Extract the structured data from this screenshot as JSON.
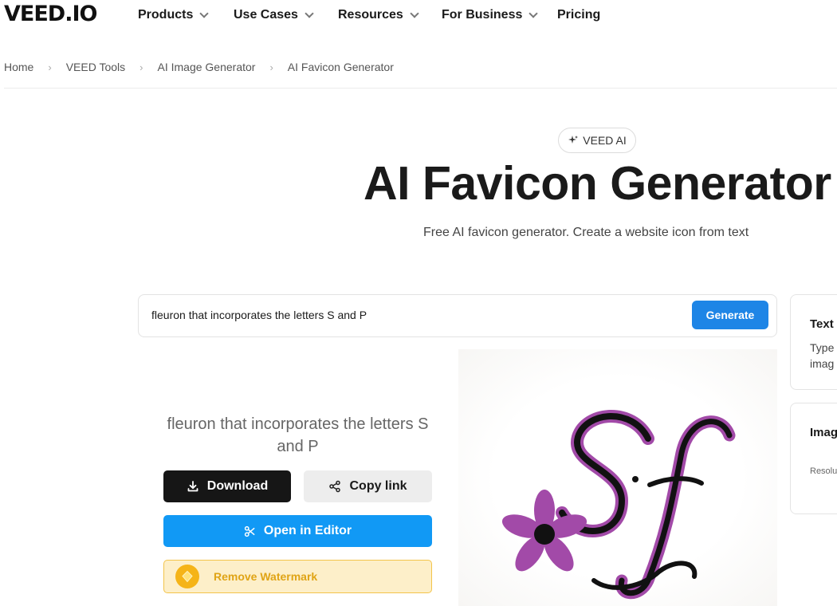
{
  "nav": {
    "logo": "VEED.IO",
    "items": [
      {
        "label": "Products",
        "has_dropdown": true
      },
      {
        "label": "Use Cases",
        "has_dropdown": true
      },
      {
        "label": "Resources",
        "has_dropdown": true
      },
      {
        "label": "For Business",
        "has_dropdown": true
      },
      {
        "label": "Pricing",
        "has_dropdown": false
      }
    ]
  },
  "breadcrumb": [
    "Home",
    "VEED Tools",
    "AI Image Generator",
    "AI Favicon Generator"
  ],
  "hero": {
    "badge": "VEED AI",
    "title": "AI Favicon Generator",
    "subtitle": "Free AI favicon generator. Create a website icon from text"
  },
  "prompt": {
    "value": "fleuron that incorporates the letters S and P",
    "generate_label": "Generate"
  },
  "result": {
    "prompt_text": "fleuron that incorporates the letters S and P",
    "download_label": "Download",
    "copy_label": "Copy link",
    "editor_label": "Open in Editor",
    "watermark_label": "Remove Watermark"
  },
  "side_cards": {
    "text_title": "Text",
    "text_desc_1": "Type",
    "text_desc_2": "imag",
    "image_title": "Imag",
    "image_res": "Resolu"
  },
  "colors": {
    "generate": "#1e85e6",
    "editor": "#1199f5",
    "download": "#161616",
    "watermark_bg": "#fdefc9",
    "watermark_text": "#e0a415",
    "flower": "#a24aa8"
  }
}
